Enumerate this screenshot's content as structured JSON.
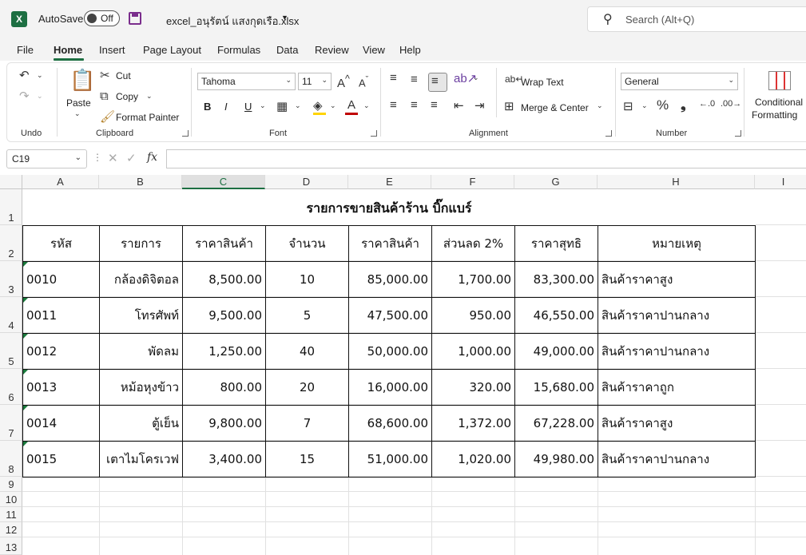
{
  "titlebar": {
    "app_icon": "X",
    "autosave_label": "AutoSave",
    "autosave_state": "Off",
    "filename": "excel_อนุรัตน์ แสงกุดเรือ.xlsx",
    "search_placeholder": "Search (Alt+Q)"
  },
  "tabs": [
    "File",
    "Home",
    "Insert",
    "Page Layout",
    "Formulas",
    "Data",
    "Review",
    "View",
    "Help"
  ],
  "ribbon": {
    "groups": {
      "undo": "Undo",
      "clipboard": "Clipboard",
      "font": "Font",
      "alignment": "Alignment",
      "number": "Number"
    },
    "clipboard": {
      "paste": "Paste",
      "cut": "Cut",
      "copy": "Copy",
      "format_painter": "Format Painter"
    },
    "font": {
      "name": "Tahoma",
      "size": "11",
      "bold": "B",
      "italic": "I",
      "underline": "U"
    },
    "alignment": {
      "wrap_text": "Wrap Text",
      "merge_center": "Merge & Center"
    },
    "number": {
      "format": "General"
    },
    "styles": {
      "conditional_line1": "Conditional",
      "conditional_line2": "Formatting"
    }
  },
  "formula_bar": {
    "name_box": "C19",
    "fx": "fx",
    "content": ""
  },
  "columns": [
    "A",
    "B",
    "C",
    "D",
    "E",
    "F",
    "G",
    "H",
    "I"
  ],
  "rows": [
    "1",
    "2",
    "3",
    "4",
    "5",
    "6",
    "7",
    "8",
    "9",
    "10",
    "11",
    "12",
    "13"
  ],
  "sheet": {
    "title": "รายการขายสินค้าร้าน บิ๊กแบร์",
    "headers": [
      "รหัส",
      "รายการ",
      "ราคาสินค้า",
      "จำนวน",
      "ราคาสินค้า",
      "ส่วนลด 2%",
      "ราคาสุทธิ",
      "หมายเหตุ"
    ],
    "rows": [
      [
        "0010",
        "กล้องดิจิตอล",
        "8,500.00",
        "10",
        "85,000.00",
        "1,700.00",
        "83,300.00",
        "สินค้าราคาสูง"
      ],
      [
        "0011",
        "โทรศัพท์",
        "9,500.00",
        "5",
        "47,500.00",
        "950.00",
        "46,550.00",
        "สินค้าราคาปานกลาง"
      ],
      [
        "0012",
        "พัดลม",
        "1,250.00",
        "40",
        "50,000.00",
        "1,000.00",
        "49,000.00",
        "สินค้าราคาปานกลาง"
      ],
      [
        "0013",
        "หม้อหุงข้าว",
        "800.00",
        "20",
        "16,000.00",
        "320.00",
        "15,680.00",
        "สินค้าราคาถูก"
      ],
      [
        "0014",
        "ตู้เย็น",
        "9,800.00",
        "7",
        "68,600.00",
        "1,372.00",
        "67,228.00",
        "สินค้าราคาสูง"
      ],
      [
        "0015",
        "เตาไมโครเวฟ",
        "3,400.00",
        "15",
        "51,000.00",
        "1,020.00",
        "49,980.00",
        "สินค้าราคาปานกลาง"
      ]
    ]
  },
  "selected_column": "C",
  "colors": {
    "accent": "#1d6f42",
    "title_bg": "#f3f3f3"
  }
}
